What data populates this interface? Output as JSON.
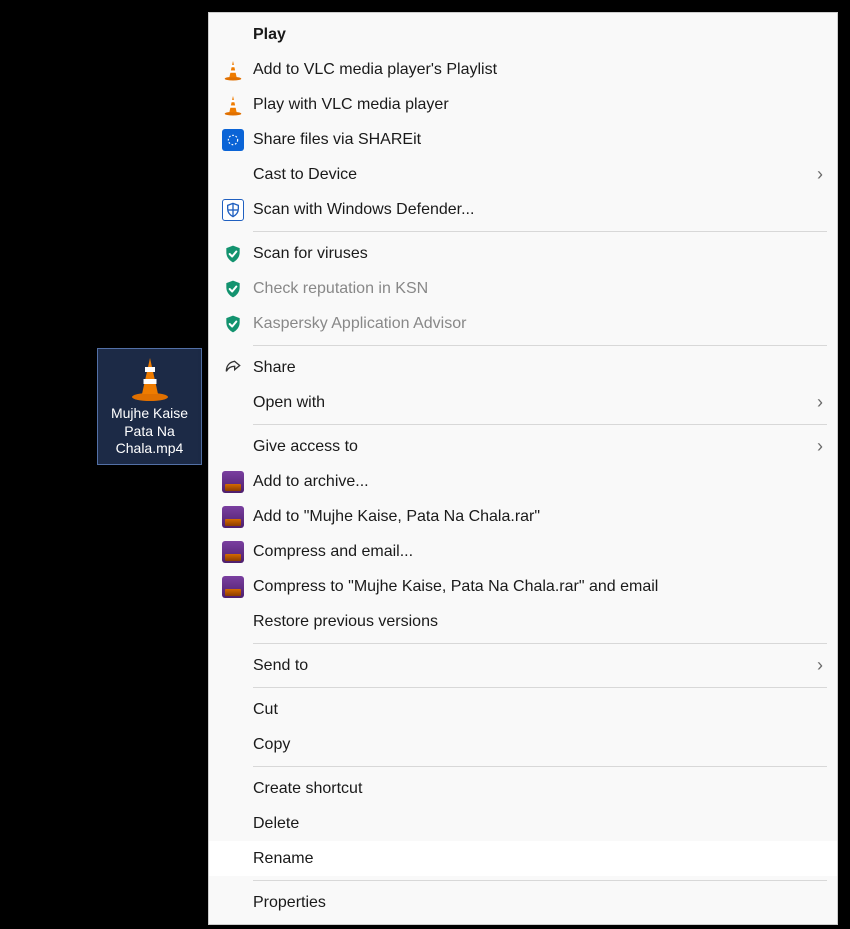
{
  "file": {
    "name": "Mujhe Kaise Pata Na Chala.mp4"
  },
  "menu": {
    "play": "Play",
    "vlc_add": "Add to VLC media player's Playlist",
    "vlc_play": "Play with VLC media player",
    "shareit": "Share files via SHAREit",
    "cast": "Cast to Device",
    "defender": "Scan with Windows Defender...",
    "scan_virus": "Scan for viruses",
    "check_ksn": "Check reputation in KSN",
    "kaspersky_advisor": "Kaspersky Application Advisor",
    "share": "Share",
    "open_with": "Open with",
    "give_access": "Give access to",
    "archive_add": "Add to archive...",
    "archive_named": "Add to \"Mujhe Kaise, Pata Na Chala.rar\"",
    "compress_email": "Compress and email...",
    "compress_named_email": "Compress to \"Mujhe Kaise, Pata Na Chala.rar\" and email",
    "restore": "Restore previous versions",
    "send_to": "Send to",
    "cut": "Cut",
    "copy": "Copy",
    "create_shortcut": "Create shortcut",
    "delete": "Delete",
    "rename": "Rename",
    "properties": "Properties"
  }
}
